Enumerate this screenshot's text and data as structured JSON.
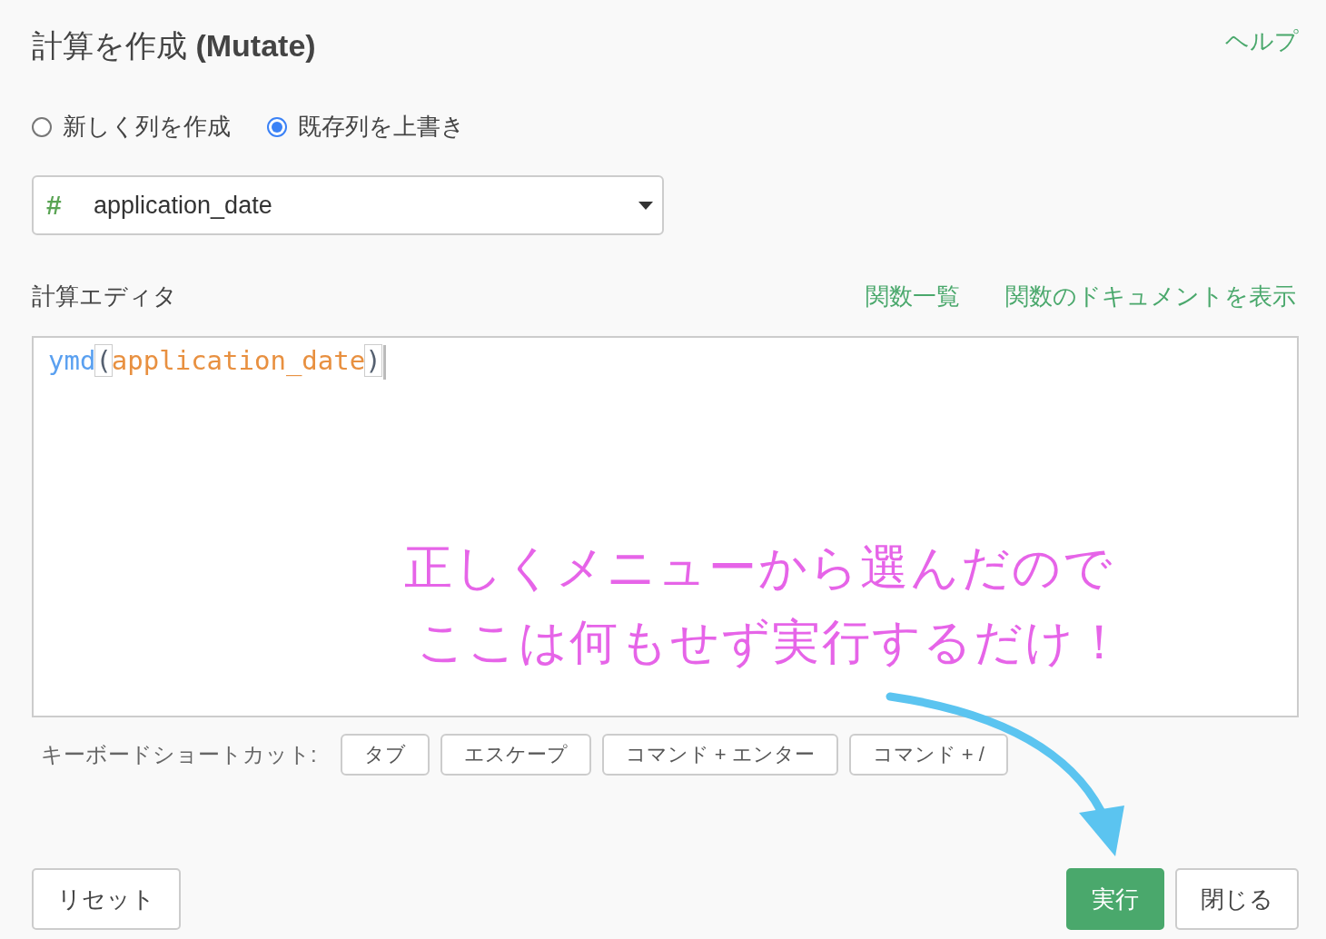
{
  "dialog": {
    "title": "計算を作成 **(Mutate)**",
    "help_link": "ヘルプ"
  },
  "mode_options": [
    {
      "label": "新しく列を作成",
      "selected": false
    },
    {
      "label": "既存列を上書き",
      "selected": true
    }
  ],
  "column_select": {
    "type_icon": "#",
    "value": "application_date"
  },
  "editor": {
    "label": "計算エディタ",
    "links": [
      "関数一覧",
      "関数のドキュメントを表示"
    ],
    "code_tokens": [
      {
        "kind": "function",
        "text": "ymd"
      },
      {
        "kind": "paren",
        "text": "("
      },
      {
        "kind": "column",
        "text": "application_date"
      },
      {
        "kind": "paren",
        "text": ")"
      }
    ]
  },
  "shortcuts": {
    "label": "キーボードショートカット:",
    "keys": [
      "タブ",
      "エスケープ",
      "コマンド + エンター",
      "コマンド + /"
    ]
  },
  "annotation": {
    "lines": [
      "正しくメニューから選んだので",
      "ここは何もせず実行するだけ！"
    ]
  },
  "footer": {
    "reset_button": "リセット",
    "run_button": "実行",
    "close_button": "閉じる"
  }
}
